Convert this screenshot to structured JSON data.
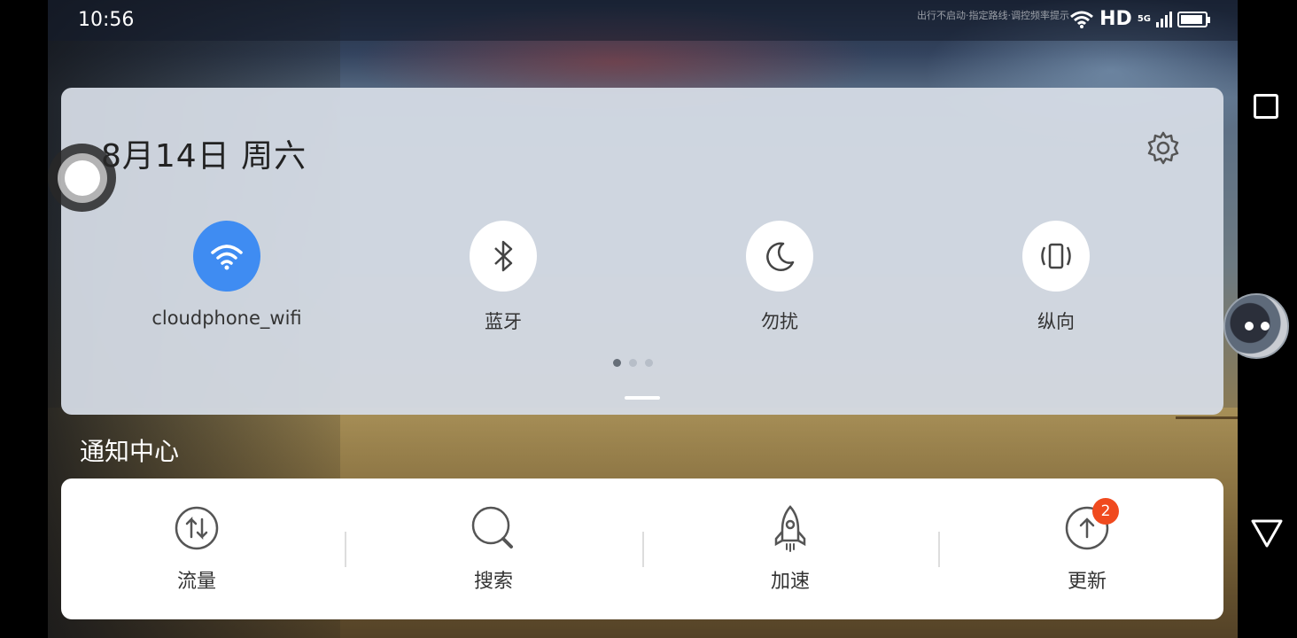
{
  "status_bar": {
    "time": "10:56",
    "network": "HD",
    "network_sub": "5G",
    "notice": "出行不启动·指定路线·调控频率提示"
  },
  "quick_settings": {
    "date": "8月14日 周六",
    "tiles": [
      {
        "label": "cloudphone_wifi",
        "icon": "wifi-icon",
        "active": true
      },
      {
        "label": "蓝牙",
        "icon": "bluetooth-icon",
        "active": false
      },
      {
        "label": "勿扰",
        "icon": "moon-icon",
        "active": false
      },
      {
        "label": "纵向",
        "icon": "rotation-lock-icon",
        "active": false
      }
    ],
    "page_count": 3,
    "current_page": 1
  },
  "notification_center": {
    "title": "通知中心",
    "items": [
      {
        "label": "流量",
        "icon": "data-usage-icon"
      },
      {
        "label": "搜索",
        "icon": "search-icon"
      },
      {
        "label": "加速",
        "icon": "rocket-icon"
      },
      {
        "label": "更新",
        "icon": "update-icon",
        "badge": "2"
      }
    ]
  },
  "colors": {
    "accent": "#3f8cf2",
    "badge": "#f04a1e",
    "panel": "#d6dce5"
  }
}
